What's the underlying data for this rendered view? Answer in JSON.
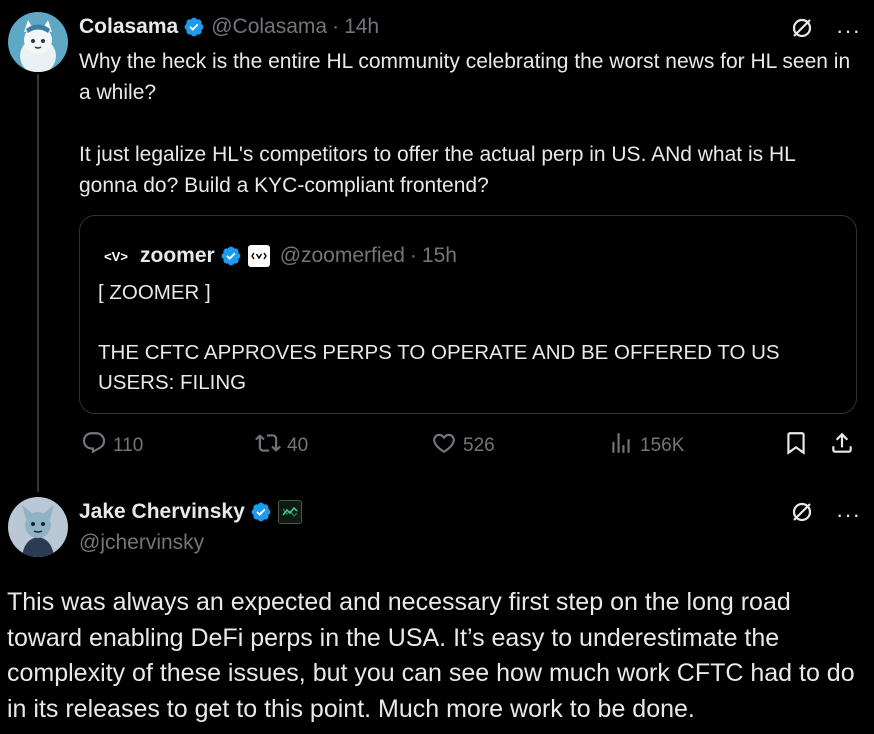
{
  "tweet": {
    "author_name": "Colasama",
    "handle": "@Colasama",
    "separator": "·",
    "time": "14h",
    "body": "Why the heck is the entire HL community celebrating the worst news for HL seen in a while?\n\nIt just legalize HL's competitors to offer the actual perp in US. ANd what is HL gonna do? Build a KYC-compliant frontend?",
    "quote": {
      "author_name": "zoomer",
      "logo_text": "<V>",
      "handle": "@zoomerfied",
      "separator": "·",
      "time": "15h",
      "body": "[ ZOOMER ]\n\nTHE CFTC APPROVES PERPS TO OPERATE AND BE OFFERED TO US USERS: FILING"
    },
    "stats": {
      "replies": "110",
      "reposts": "40",
      "likes": "526",
      "views": "156K"
    }
  },
  "reply": {
    "author_name": "Jake Chervinsky",
    "handle": "@jchervinsky",
    "body": "This was always an expected and necessary first step on the long road toward enabling DeFi perps in the USA. It’s easy to underestimate the complexity of these issues, but you can see how much work CFTC had to do in its releases to get to this point. Much more work to be done."
  },
  "icons": {
    "verified": "verified-badge-icon",
    "grok": "grok-icon",
    "more": "more-icon",
    "reply": "reply-icon",
    "repost": "repost-icon",
    "like": "like-icon",
    "views": "views-icon",
    "bookmark": "bookmark-icon",
    "share": "share-icon"
  },
  "colors": {
    "background": "#000000",
    "text": "#e7e9ea",
    "muted": "#71767b",
    "verified": "#1d9bf0",
    "border": "#2f3336"
  }
}
